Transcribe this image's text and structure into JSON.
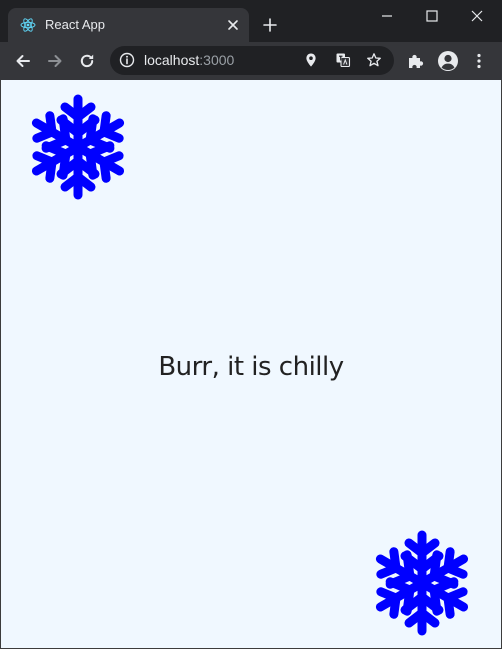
{
  "browser": {
    "tab": {
      "title": "React App",
      "favicon": "react-logo-icon"
    },
    "address": {
      "host": "localhost",
      "port": ":3000"
    }
  },
  "page": {
    "heading": "Burr, it is chilly",
    "background_color": "#f0f8ff",
    "snowflake_color": "#0000ff",
    "icons": [
      "snowflake-icon",
      "snowflake-icon"
    ]
  }
}
